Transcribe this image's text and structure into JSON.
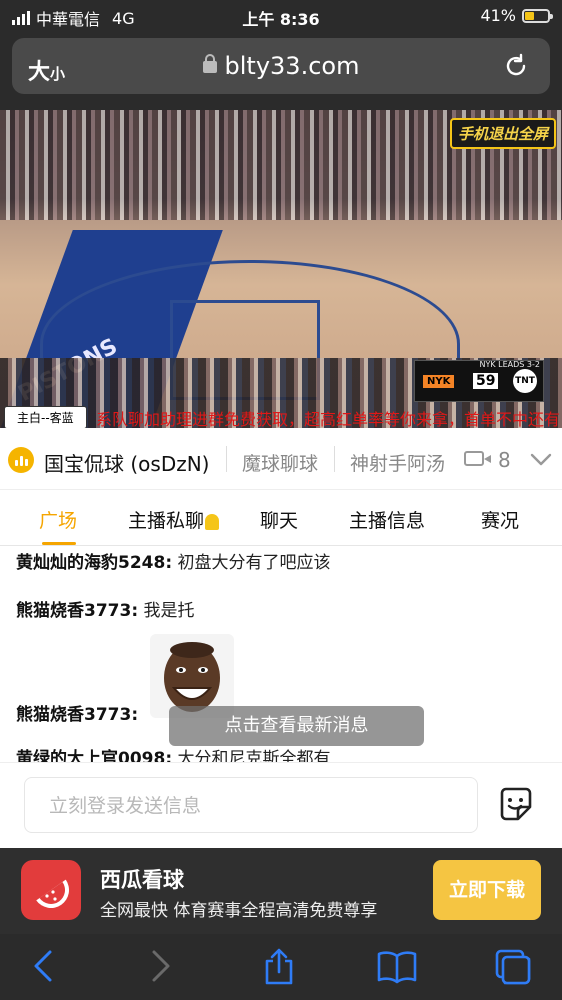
{
  "status_bar": {
    "carrier": "中華電信",
    "network": "4G",
    "time": "上午 8:36",
    "battery_text": "41%",
    "battery_level": 0.41
  },
  "browser": {
    "text_size_label": "大",
    "text_size_small": "小",
    "domain": "blty33.com",
    "icons": [
      "lock-icon",
      "reload-icon"
    ]
  },
  "video": {
    "fullscreen_badge": "手机退出全屏",
    "team_toggle": "主白--客蓝",
    "ticker_text": "系队聊加助理进群免费获取，超高红单率等你来拿，首单不中还有",
    "court_text": "PISTONS",
    "scoreboard": {
      "team": "NYK",
      "score": "59",
      "leads_text": "NYK LEADS 3-2",
      "network": "TNT"
    }
  },
  "channel": {
    "name": "国宝侃球 (osDzN)",
    "tabs": [
      "魔球聊球",
      "神射手阿汤"
    ],
    "viewer_count": "8"
  },
  "tabs": {
    "items": [
      "广场",
      "主播私聊",
      "聊天",
      "主播信息",
      "赛况"
    ],
    "active": "广场"
  },
  "chat": {
    "messages": [
      {
        "user": "黄灿灿的海豹5248:",
        "text": "初盘大分有了吧应该"
      },
      {
        "user": "熊猫烧香3773:",
        "text": "我是托"
      },
      {
        "user": "熊猫烧香3773:",
        "text": ""
      },
      {
        "user": "黄绿的大上官0098:",
        "text": "大分和尼克斯全都有"
      }
    ],
    "new_message_toast": "点击查看最新消息"
  },
  "input": {
    "placeholder": "立刻登录发送信息"
  },
  "ad": {
    "title": "西瓜看球",
    "subtitle": "全网最快 体育赛事全程高清免费尊享",
    "button": "立即下载"
  },
  "colors": {
    "accent": "#f5a500",
    "dark_chrome": "#2b2b2b",
    "ios_blue": "#2f7cf6",
    "ad_button": "#f5c542"
  }
}
